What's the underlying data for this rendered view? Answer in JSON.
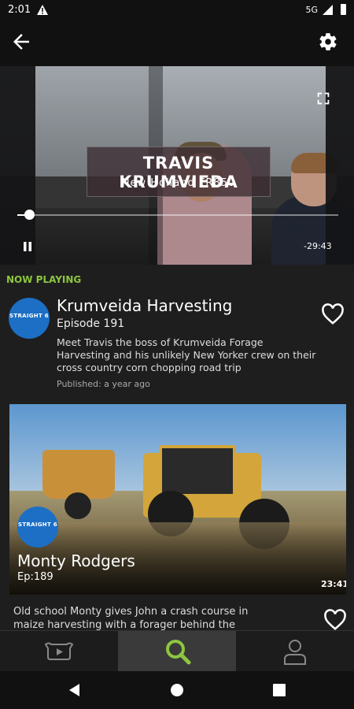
{
  "status_bar": {
    "time": "2:01",
    "network": "5G",
    "icons": [
      "warning-icon",
      "signal-icon",
      "battery-icon"
    ]
  },
  "app_bar": {
    "icons": [
      "back-arrow-icon",
      "gear-icon"
    ]
  },
  "video": {
    "lower_third_name": "TRAVIS KRUMVIEDA",
    "lower_third_sub": "New Holland FR850",
    "remaining_time": "-29:43",
    "progress": 0.02
  },
  "now_playing": {
    "label": "NOW PLAYING",
    "logo_text": "STRAIGHT 6",
    "title": "Krumveida Harvesting",
    "episode": "Episode 191",
    "description": "Meet Travis the boss of Krumveida Forage Harvesting and his unlikely New Yorker crew on their cross country corn chopping road trip",
    "published": "Published: a year ago"
  },
  "next_card": {
    "logo_text": "STRAIGHT 6",
    "title": "Monty Rodgers",
    "episode": "Ep:189",
    "duration": "23:41",
    "description": "Old school Monty gives John a crash course in maize harvesting with a forager behind the"
  },
  "bottom_nav": {
    "items": [
      "videos-icon",
      "search-icon",
      "profile-icon"
    ],
    "active": "search-icon",
    "accent": "#8dc63f"
  },
  "system_nav": [
    "back-triangle-icon",
    "home-circle-icon",
    "recents-square-icon"
  ]
}
